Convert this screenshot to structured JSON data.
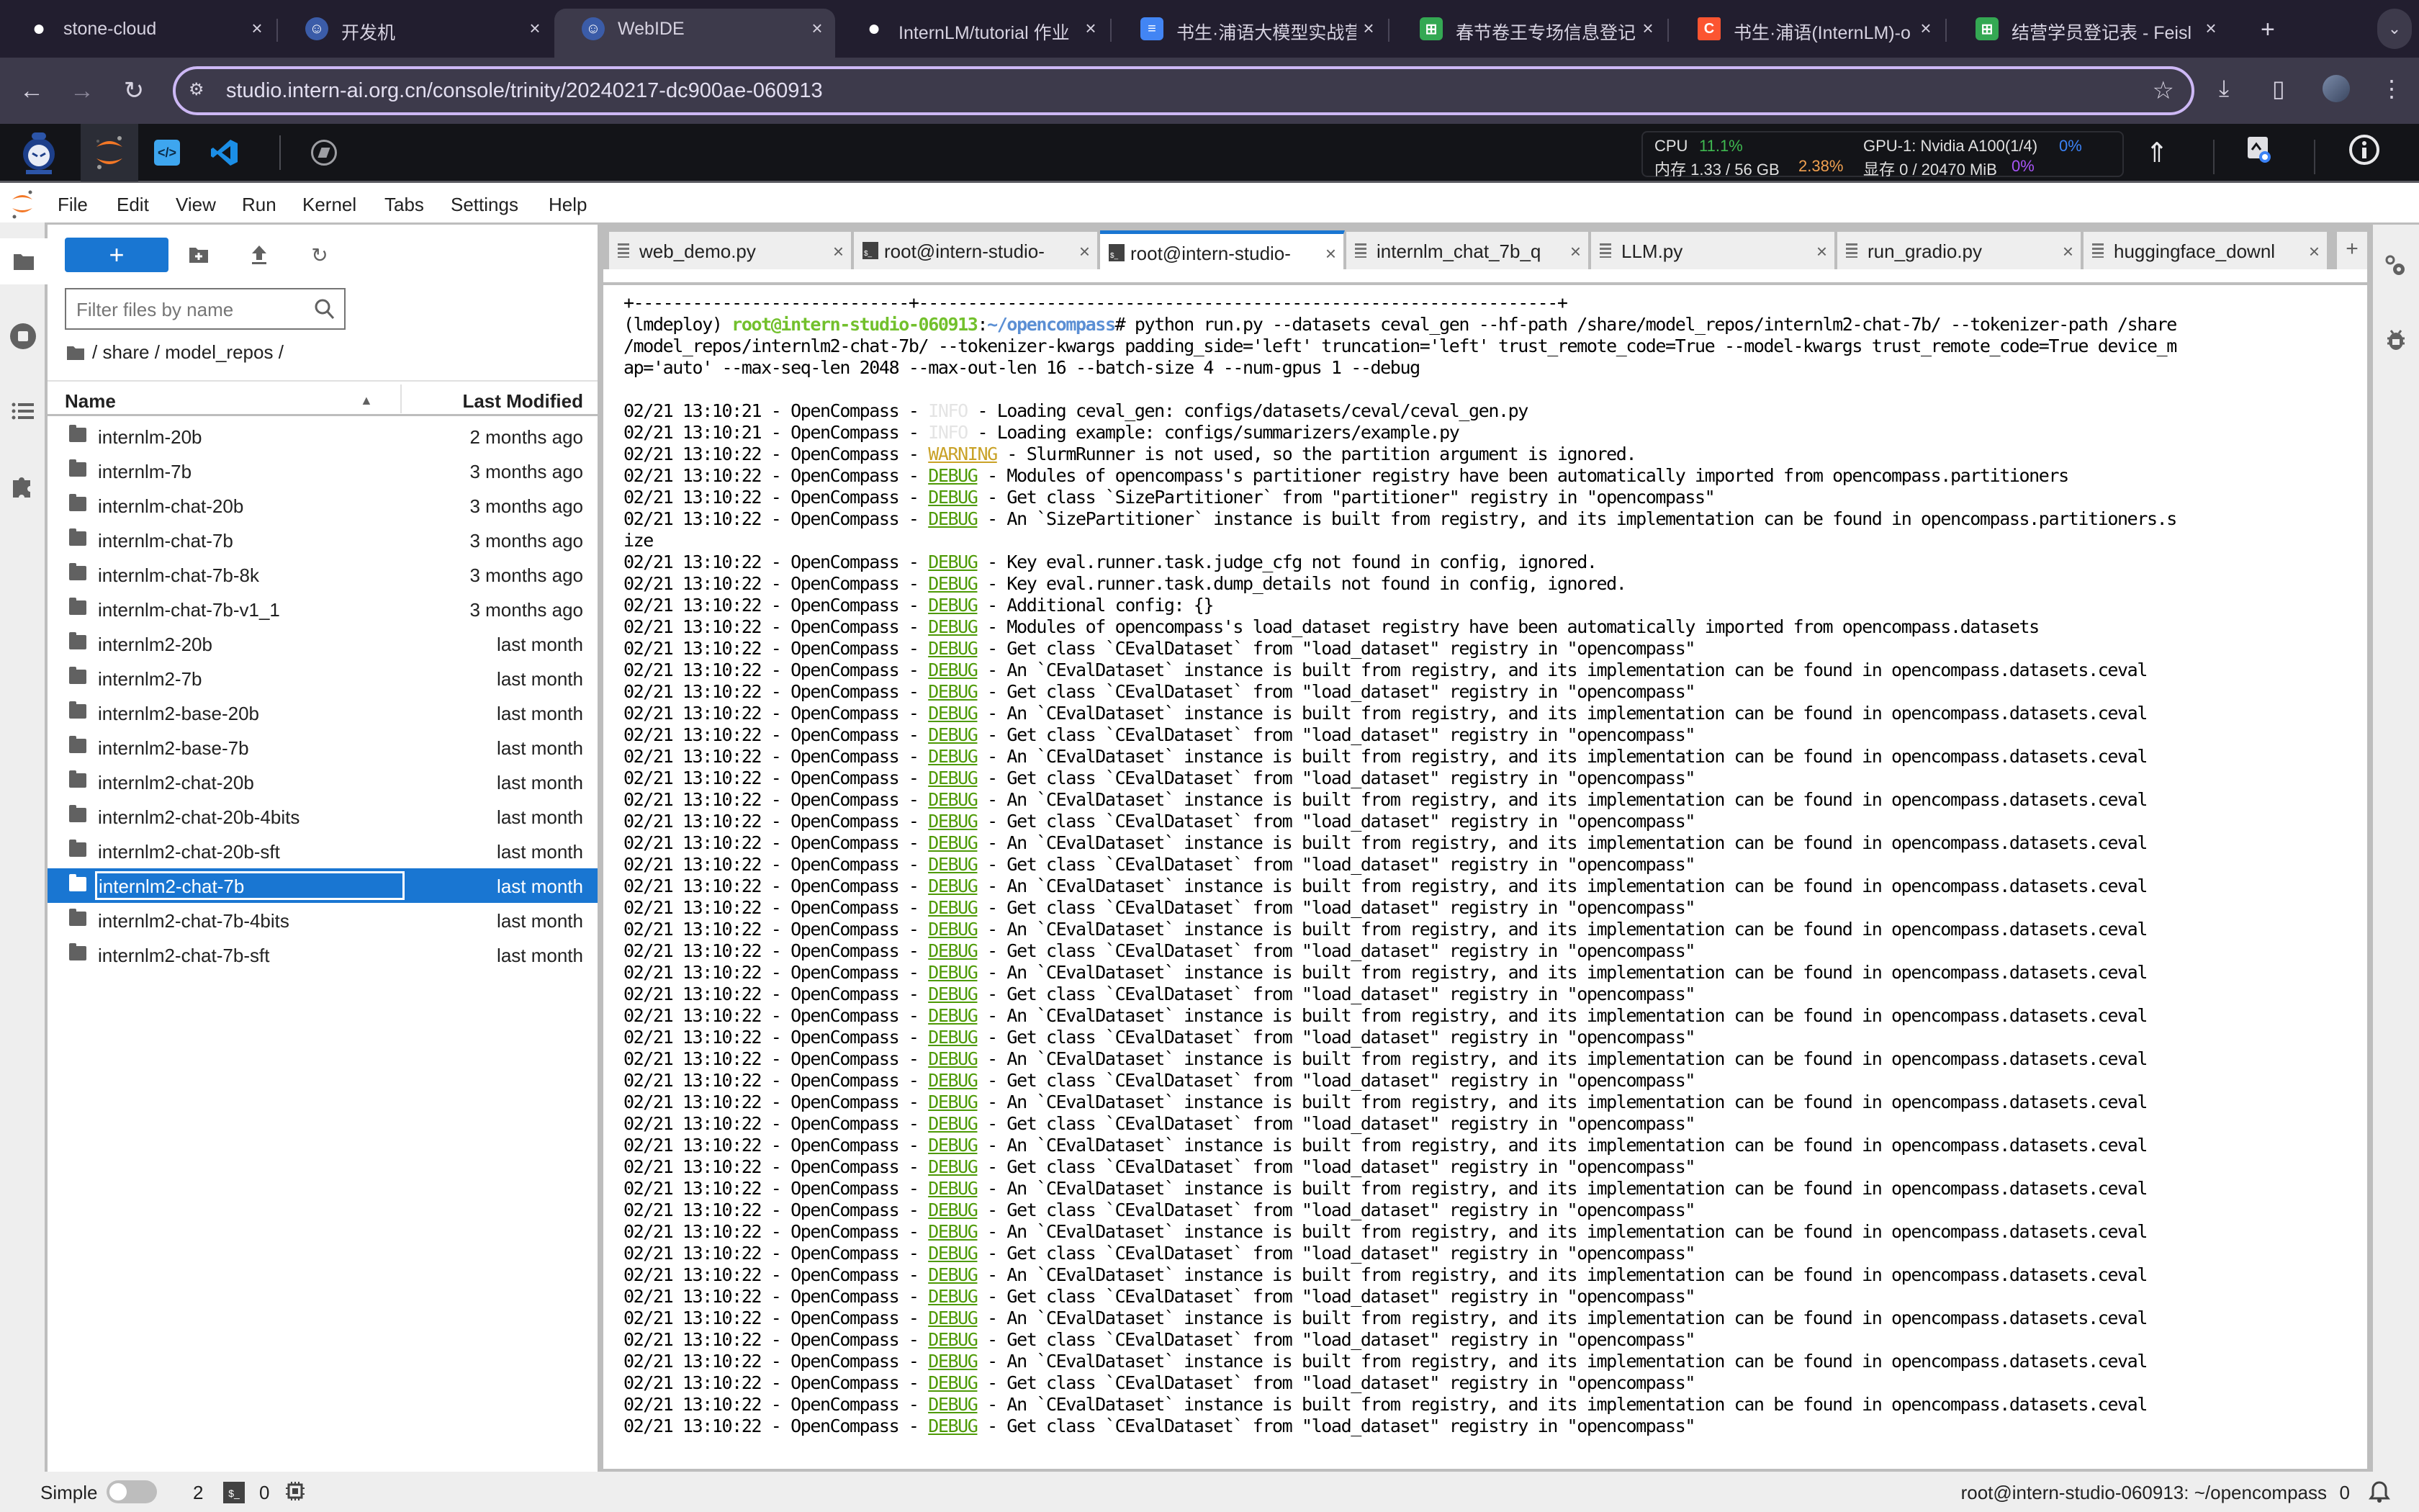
{
  "browser": {
    "tabs": [
      {
        "title": "stone-cloud",
        "icon": "github-icon"
      },
      {
        "title": "开发机",
        "icon": "intern-logo-icon"
      },
      {
        "title": "WebIDE",
        "icon": "intern-logo-icon",
        "active": true
      },
      {
        "title": "InternLM/tutorial 作业",
        "icon": "github-icon"
      },
      {
        "title": "书生·浦语大模型实战营",
        "icon": "docs-icon"
      },
      {
        "title": "春节卷王专场信息登记",
        "icon": "sheets-icon"
      },
      {
        "title": "书生·浦语(InternLM)-o",
        "icon": "csdn-icon"
      },
      {
        "title": "结营学员登记表 - Feisl",
        "icon": "sheets-icon"
      }
    ],
    "new_tab": "+",
    "tab_menu": "⌄",
    "url": "studio.intern-ai.org.cn/console/trinity/20240217-dc900ae-060913",
    "back": "←",
    "forward": "→",
    "reload": "↻",
    "bookmark_star": "☆",
    "download": "⤓",
    "sidepanel": "▯",
    "more": "⋮"
  },
  "studio": {
    "resources": {
      "cpu_label": "CPU",
      "cpu_value": "11.1%",
      "mem_label": "内存 1.33 / 56 GB",
      "mem_value": "2.38%",
      "gpu_label": "GPU-1: Nvidia A100(1/4)",
      "gpu_value": "0%",
      "vram_label": "显存 0 / 20470 MiB",
      "vram_value": "0%"
    },
    "colors": {
      "cpu": "#3fb950",
      "mem": "#f0a050",
      "gpu": "#3b82f6",
      "vram": "#a855f7"
    }
  },
  "menubar": [
    "File",
    "Edit",
    "View",
    "Run",
    "Kernel",
    "Tabs",
    "Settings",
    "Help"
  ],
  "filebrowser": {
    "new_label": "+",
    "filter_placeholder": "Filter files by name",
    "breadcrumb": "/ share / model_repos /",
    "col_name": "Name",
    "col_modified": "Last Modified",
    "sort_indicator": "▲",
    "files": [
      {
        "name": "internlm-20b",
        "modified": "2 months ago"
      },
      {
        "name": "internlm-7b",
        "modified": "3 months ago"
      },
      {
        "name": "internlm-chat-20b",
        "modified": "3 months ago"
      },
      {
        "name": "internlm-chat-7b",
        "modified": "3 months ago"
      },
      {
        "name": "internlm-chat-7b-8k",
        "modified": "3 months ago"
      },
      {
        "name": "internlm-chat-7b-v1_1",
        "modified": "3 months ago"
      },
      {
        "name": "internlm2-20b",
        "modified": "last month"
      },
      {
        "name": "internlm2-7b",
        "modified": "last month"
      },
      {
        "name": "internlm2-base-20b",
        "modified": "last month"
      },
      {
        "name": "internlm2-base-7b",
        "modified": "last month"
      },
      {
        "name": "internlm2-chat-20b",
        "modified": "last month"
      },
      {
        "name": "internlm2-chat-20b-4bits",
        "modified": "last month"
      },
      {
        "name": "internlm2-chat-20b-sft",
        "modified": "last month"
      },
      {
        "name": "internlm2-chat-7b",
        "modified": "last month",
        "selected": true
      },
      {
        "name": "internlm2-chat-7b-4bits",
        "modified": "last month"
      },
      {
        "name": "internlm2-chat-7b-sft",
        "modified": "last month"
      }
    ]
  },
  "doc_tabs": [
    {
      "label": "web_demo.py",
      "type": "text"
    },
    {
      "label": "root@intern-studio-",
      "type": "terminal"
    },
    {
      "label": "root@intern-studio-",
      "type": "terminal",
      "active": true
    },
    {
      "label": "internlm_chat_7b_q",
      "type": "text"
    },
    {
      "label": "LLM.py",
      "type": "text"
    },
    {
      "label": "run_gradio.py",
      "type": "text"
    },
    {
      "label": "huggingface_downl",
      "type": "text"
    }
  ],
  "terminal": {
    "separator": "+----------------------------+-----------------------------------------------------------------+",
    "prompt_env": "(lmdeploy) ",
    "prompt_user": "root@intern-studio-060913",
    "prompt_colon": ":",
    "prompt_path": "~/opencompass",
    "prompt_hash": "# ",
    "command_lines": [
      "python run.py --datasets ceval_gen --hf-path /share/model_repos/internlm2-chat-7b/ --tokenizer-path /share",
      "/model_repos/internlm2-chat-7b/ --tokenizer-kwargs padding_side='left' truncation='left' trust_remote_code=True --model-kwargs trust_remote_code=True device_m",
      "ap='auto' --max-seq-len 2048 --max-out-len 16 --batch-size 4 --num-gpus 1 --debug"
    ],
    "log_lines": [
      {
        "ts": "02/21 13:10:21",
        "src": "OpenCompass",
        "level": "INFO",
        "msg": "Loading ceval_gen: configs/datasets/ceval/ceval_gen.py"
      },
      {
        "ts": "02/21 13:10:21",
        "src": "OpenCompass",
        "level": "INFO",
        "msg": "Loading example: configs/summarizers/example.py"
      },
      {
        "ts": "02/21 13:10:22",
        "src": "OpenCompass",
        "level": "WARNING",
        "msg": "SlurmRunner is not used, so the partition argument is ignored."
      },
      {
        "ts": "02/21 13:10:22",
        "src": "OpenCompass",
        "level": "DEBUG",
        "msg": "Modules of opencompass's partitioner registry have been automatically imported from opencompass.partitioners"
      },
      {
        "ts": "02/21 13:10:22",
        "src": "OpenCompass",
        "level": "DEBUG",
        "msg": "Get class `SizePartitioner` from \"partitioner\" registry in \"opencompass\""
      },
      {
        "ts": "02/21 13:10:22",
        "src": "OpenCompass",
        "level": "DEBUG",
        "msg": "An `SizePartitioner` instance is built from registry, and its implementation can be found in opencompass.partitioners.s",
        "wrap": "ize"
      },
      {
        "ts": "02/21 13:10:22",
        "src": "OpenCompass",
        "level": "DEBUG",
        "msg": "Key eval.runner.task.judge_cfg not found in config, ignored."
      },
      {
        "ts": "02/21 13:10:22",
        "src": "OpenCompass",
        "level": "DEBUG",
        "msg": "Key eval.runner.task.dump_details not found in config, ignored."
      },
      {
        "ts": "02/21 13:10:22",
        "src": "OpenCompass",
        "level": "DEBUG",
        "msg": "Additional config: {}"
      },
      {
        "ts": "02/21 13:10:22",
        "src": "OpenCompass",
        "level": "DEBUG",
        "msg": "Modules of opencompass's load_dataset registry have been automatically imported from opencompass.datasets"
      }
    ],
    "repeat_get": "Get class `CEvalDataset` from \"load_dataset\" registry in \"opencompass\"",
    "repeat_built": "An `CEvalDataset` instance is built from registry, and its implementation can be found in opencompass.datasets.ceval",
    "repeat_ts": "02/21 13:10:22",
    "repeat_src": "OpenCompass",
    "repeat_pairs": 18
  },
  "statusbar": {
    "mode_label": "Simple",
    "terminals_count": "2",
    "terminal_badge": "$_",
    "kernels_count": "0",
    "right_text": "root@intern-studio-060913: ~/opencompass",
    "notifications": "0"
  }
}
